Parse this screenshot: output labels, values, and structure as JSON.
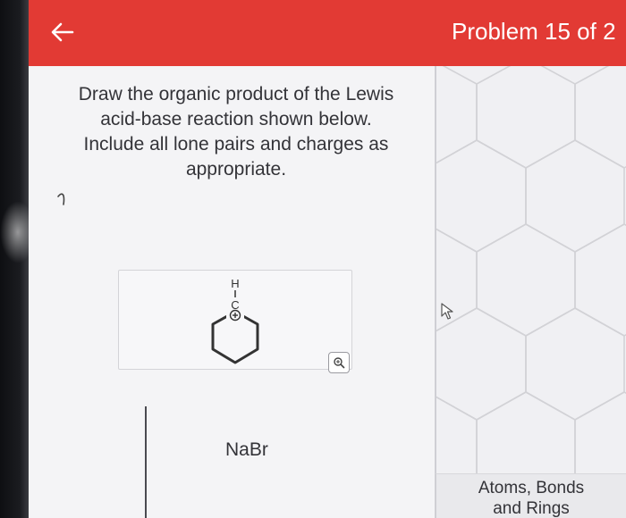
{
  "header": {
    "back_icon": "arrow-left-icon",
    "title": "Problem 15 of 2",
    "color": "#e23a34"
  },
  "prompt": {
    "lines": [
      "Draw the organic product of the Lewis",
      "acid-base reaction shown below.",
      "Include all lone pairs and charges as",
      "appropriate."
    ]
  },
  "reactant": {
    "atom_h": "H",
    "atom_c": "C",
    "charge": "+",
    "zoom_icon": "magnify-icon"
  },
  "reagent": {
    "label": "NaBr"
  },
  "drawing_panel": {
    "pattern": "hexagon-grid",
    "cursor_icon": "pointer-cursor-icon"
  },
  "toolbar": {
    "line1": "Atoms, Bonds",
    "line2": "and Rings"
  }
}
